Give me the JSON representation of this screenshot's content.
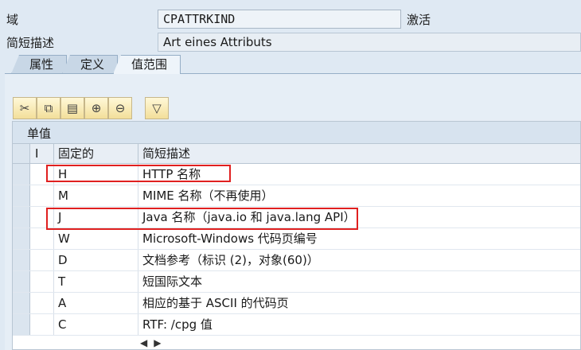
{
  "header": {
    "domain_label": "域",
    "domain_value": "CPATTRKIND",
    "status": "激活",
    "short_desc_label": "简短描述",
    "short_desc_value": "Art eines Attributs"
  },
  "tabs": [
    {
      "label": "属性"
    },
    {
      "label": "定义"
    },
    {
      "label": "值范围"
    }
  ],
  "table": {
    "title": "单值",
    "columns": {
      "i": "I",
      "fixed": "固定的",
      "desc": "简短描述"
    },
    "rows": [
      {
        "fixed": "H",
        "desc": "HTTP 名称"
      },
      {
        "fixed": "M",
        "desc": "MIME 名称（不再使用）"
      },
      {
        "fixed": "J",
        "desc": "Java 名称（java.io 和 java.lang API）"
      },
      {
        "fixed": "W",
        "desc": "Microsoft-Windows 代码页编号"
      },
      {
        "fixed": "D",
        "desc": "文档参考（标识 (2)，对象(60)）"
      },
      {
        "fixed": "T",
        "desc": "短国际文本"
      },
      {
        "fixed": "A",
        "desc": "相应的基于 ASCII 的代码页"
      },
      {
        "fixed": "C",
        "desc": "RTF: /cpg 值"
      }
    ]
  },
  "toolbar": {
    "icons": [
      "cut-icon",
      "copy-icon",
      "paste-icon",
      "insert-row-icon",
      "delete-row-icon",
      "filter-icon"
    ]
  },
  "scroll": {
    "left": "◀",
    "right": "▶"
  }
}
